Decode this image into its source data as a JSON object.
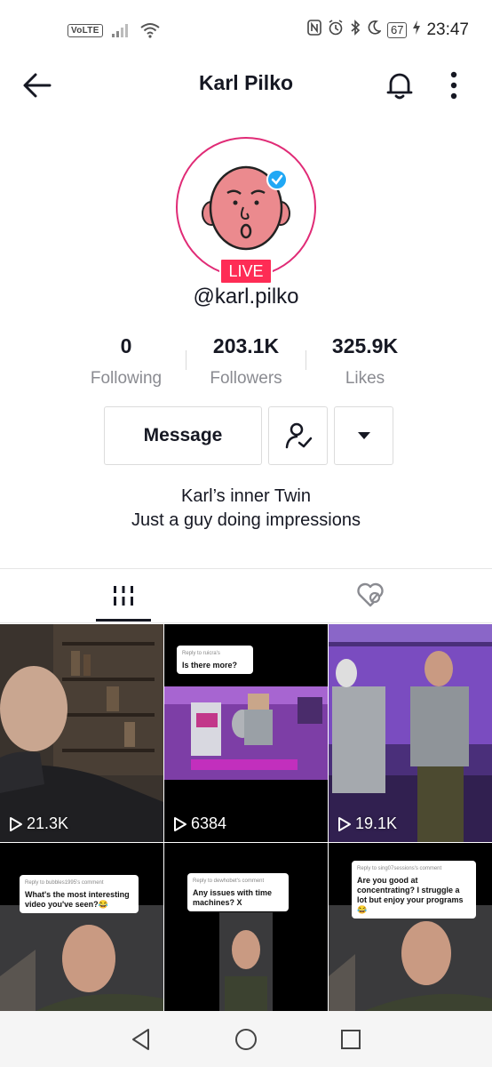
{
  "status_bar": {
    "volte": "VoLTE",
    "battery": "67",
    "time": "23:47"
  },
  "header": {
    "title": "Karl Pilko"
  },
  "profile": {
    "live_badge": "LIVE",
    "username": "@karl.pilko",
    "stats": [
      {
        "value": "0",
        "label": "Following"
      },
      {
        "value": "203.1K",
        "label": "Followers"
      },
      {
        "value": "325.9K",
        "label": "Likes"
      }
    ],
    "message_button": "Message",
    "bio_line1": "Karl’s inner Twin",
    "bio_line2": "Just a guy doing impressions"
  },
  "videos": [
    {
      "views": "21.3K"
    },
    {
      "views": "6384",
      "reply_to": "Reply to ruicra's",
      "comment": "Is there more?"
    },
    {
      "views": "19.1K"
    },
    {
      "reply_to": "Reply to bubbles1995's comment",
      "comment": "What's the most interesting video you've seen?😂"
    },
    {
      "reply_to": "Reply to dewhobet's comment",
      "comment": "Any issues with time machines? X"
    },
    {
      "reply_to": "Reply to sing07sessions's comment",
      "comment": "Are you good at concentrating? I struggle a lot but enjoy your programs 😂"
    }
  ],
  "colors": {
    "accent": "#fe2c55",
    "ring": "#e02b76",
    "verified": "#20a8f5"
  }
}
